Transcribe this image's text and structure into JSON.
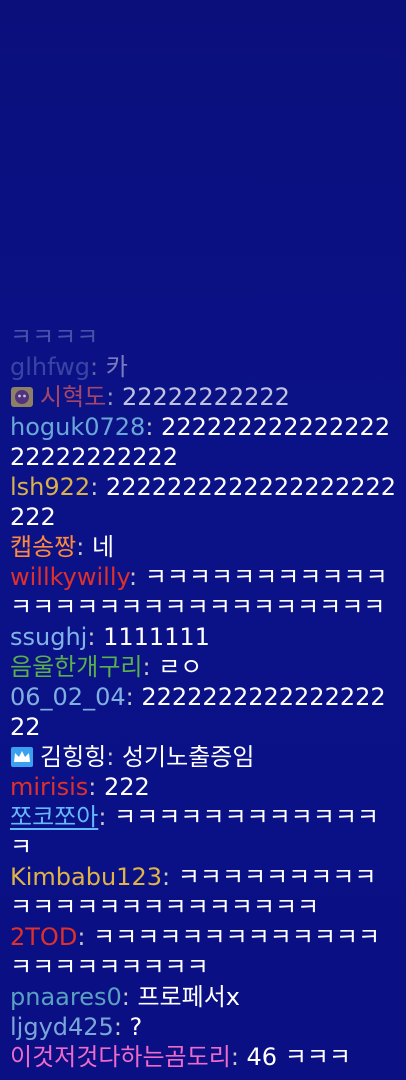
{
  "colors": {
    "background": "#0b1186",
    "message_text": "#ffffff",
    "separator": "#c8c8c8"
  },
  "messages": [
    {
      "nick": "",
      "text": "ㅋㅋㅋㅋ",
      "nick_color": "#8fa0d8",
      "faded": true
    },
    {
      "nick": "glhfwg",
      "text": "카",
      "nick_color": "#6e86c6",
      "faded": true
    },
    {
      "nick": "시혁도",
      "text": "22222222222",
      "nick_color": "#d8585f",
      "badge": "fan-badge-icon",
      "semi": true
    },
    {
      "nick": "hoguk0728",
      "text": "22222222222222222222222222",
      "nick_color": "#6aa7d8"
    },
    {
      "nick": "lsh922",
      "text": "2222222222222222222222",
      "nick_color": "#d9b04a"
    },
    {
      "nick": "캡송짱",
      "text": "네",
      "nick_color": "#ff8a3c"
    },
    {
      "nick": "willkywilly",
      "text": "ㅋㅋㅋㅋㅋㅋㅋㅋㅋㅋㅋㅋㅋㅋㅋㅋㅋㅋㅋㅋㅋㅋㅋㅋㅋㅋㅋㅋ",
      "nick_color": "#e0302a"
    },
    {
      "nick": "ssughj",
      "text": "1111111",
      "nick_color": "#7fb4e6"
    },
    {
      "nick": "음울한개구리",
      "text": "ㄹㅇ",
      "nick_color": "#5ab04a"
    },
    {
      "nick": "06_02_04",
      "text": "222222222222222222",
      "nick_color": "#7fb0e0"
    },
    {
      "nick": "김힝힝",
      "text": "성기노출증임",
      "nick_color": "#ffffff",
      "badge": "crown-badge-icon"
    },
    {
      "nick": "mirisis",
      "text": "222",
      "nick_color": "#e0302a"
    },
    {
      "nick": "쪼코쪼아",
      "text": "ㅋㅋㅋㅋㅋㅋㅋㅋㅋㅋㅋㅋㅋ",
      "nick_color": "#66b8ff",
      "underline": true
    },
    {
      "nick": "Kimbabu123",
      "text": "ㅋㅋㅋㅋㅋㅋㅋㅋㅋㅋㅋㅋㅋㅋㅋㅋㅋㅋㅋㅋㅋㅋㅋ",
      "nick_color": "#e0b347"
    },
    {
      "nick": "2TOD",
      "text": "ㅋㅋㅋㅋㅋㅋㅋㅋㅋㅋㅋㅋㅋㅋㅋㅋㅋㅋㅋㅋㅋㅋ",
      "nick_color": "#e0302a"
    },
    {
      "nick": "pnaares0",
      "text": "프로페서x",
      "nick_color": "#5aa0c0"
    },
    {
      "nick": "ljgyd425",
      "text": "?",
      "nick_color": "#7aa6d8"
    },
    {
      "nick": "이것저것다하는곰도리",
      "text": "46 ㅋㅋㅋ",
      "nick_color": "#f06acb"
    }
  ]
}
